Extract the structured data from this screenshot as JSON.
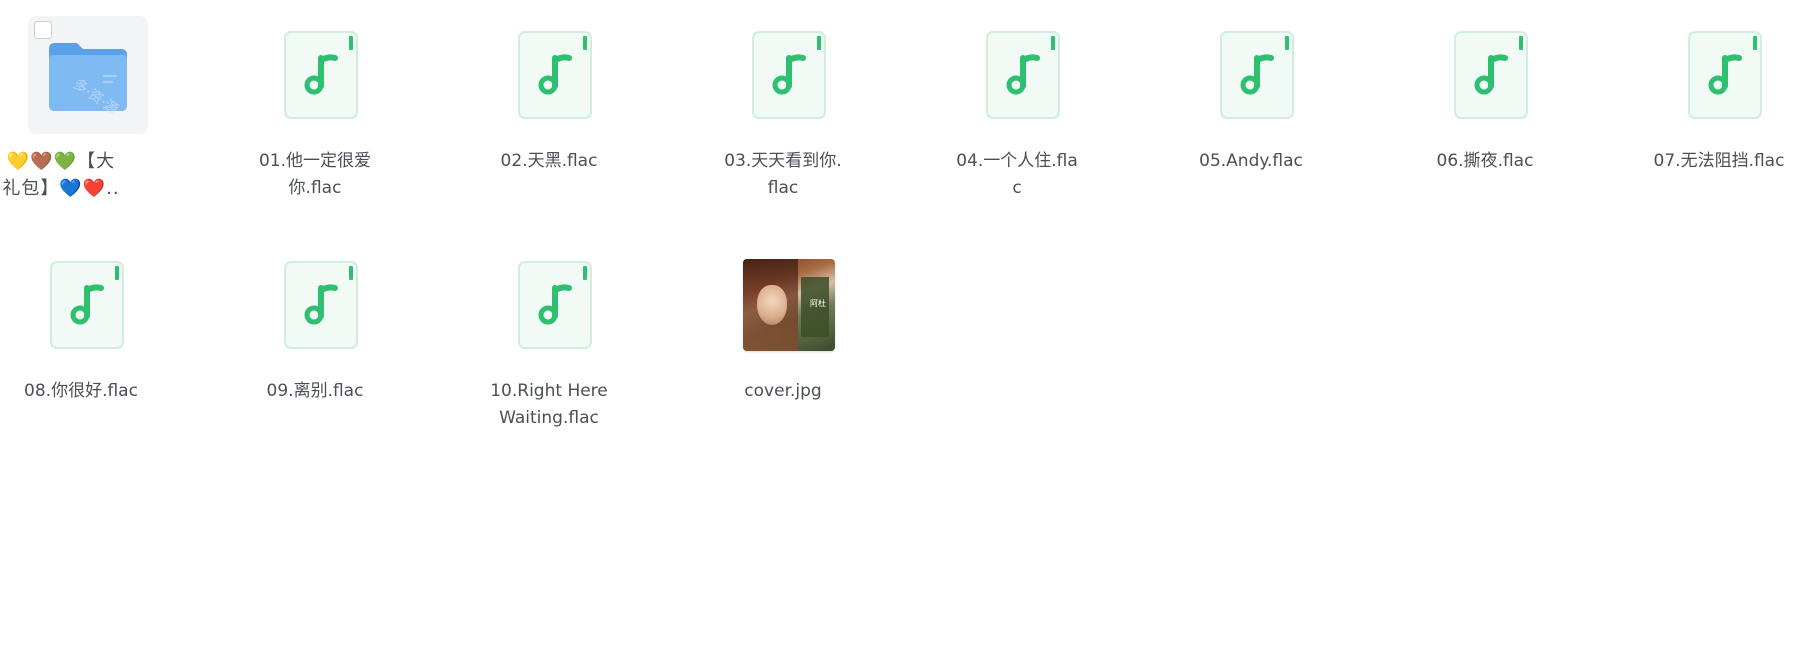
{
  "files": [
    {
      "name": "💛🤎💚【大礼包】💙❤️..",
      "type": "folder",
      "selected": true
    },
    {
      "name": "01.他一定很爱你.flac",
      "type": "audio"
    },
    {
      "name": "02.天黑.flac",
      "type": "audio"
    },
    {
      "name": "03.天天看到你.flac",
      "type": "audio"
    },
    {
      "name": "04.一个人住.flac",
      "type": "audio"
    },
    {
      "name": "05.Andy.flac",
      "type": "audio"
    },
    {
      "name": "06.撕夜.flac",
      "type": "audio"
    },
    {
      "name": "07.无法阻挡.flac",
      "type": "audio"
    },
    {
      "name": "08.你很好.flac",
      "type": "audio"
    },
    {
      "name": "09.离别.flac",
      "type": "audio"
    },
    {
      "name": "10.Right Here Waiting.flac",
      "type": "audio"
    },
    {
      "name": "cover.jpg",
      "type": "image"
    }
  ],
  "icons": {
    "folder": "folder-icon",
    "audio": "music-note-icon",
    "image": "image-thumbnail"
  },
  "colors": {
    "audio_accent": "#2fbf71",
    "audio_bg": "#f1faf5",
    "audio_border": "#cfeedd",
    "folder_blue": "#67aef0",
    "text": "#4a4f57",
    "selected_bg": "#f3f4f6"
  }
}
